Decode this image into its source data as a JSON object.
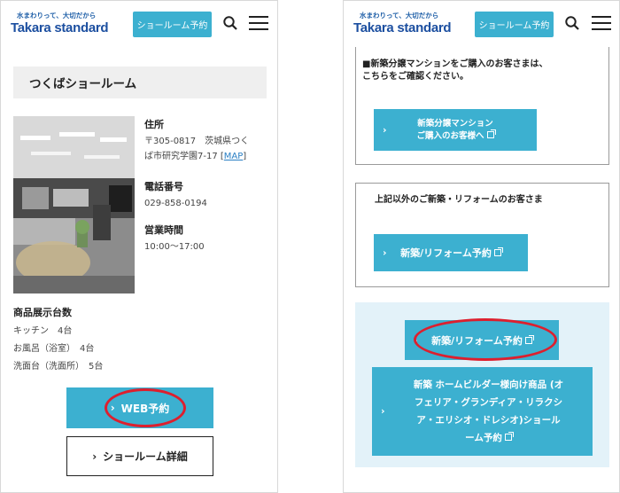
{
  "header": {
    "logo_tagline": "水まわりって、大切だから",
    "logo_name": "Takara standard",
    "showroom_booking": "ショールーム予約"
  },
  "left": {
    "title": "つくばショールーム",
    "address_label": "住所",
    "address_line1": "〒305-0817　茨城県つく",
    "address_line2": "ば市研究学園7-17",
    "map_link": "MAP",
    "phone_label": "電話番号",
    "phone": "029-858-0194",
    "hours_label": "営業時間",
    "hours": "10:00〜17:00",
    "products_label": "商品展示台数",
    "products": [
      {
        "name": "キッチン",
        "count": "4台"
      },
      {
        "name": "お風呂（浴室）",
        "count": "4台"
      },
      {
        "name": "洗面台（洗面所）",
        "count": "5台"
      }
    ],
    "web_booking": "WEB予約",
    "showroom_detail": "ショールーム詳細"
  },
  "right": {
    "box1_text_line1": "■新築分譲マンションをご購入のお客さまは、",
    "box1_text_line2": "こちらをご確認ください。",
    "box1_cta_line1": "新築分譲マンション",
    "box1_cta_line2": "ご購入のお客様へ",
    "box2_text": "上記以外のご新築・リフォームのお客さま",
    "box2_cta": "新築/リフォーム予約",
    "panel_cta1": "新築/リフォーム予約",
    "panel_cta2_line1": "新築 ホームビルダー様向け商品 (オ",
    "panel_cta2_line2": "フェリア・グランディア・リラクシ",
    "panel_cta2_line3": "ア・エリシオ・ドレシオ)ショール",
    "panel_cta2_line4": "ーム予約"
  },
  "colors": {
    "accent": "#3cb0d0",
    "brand": "#1c4fa0",
    "highlight": "#dd1f2e",
    "panel_bg": "#e3f2f9"
  }
}
